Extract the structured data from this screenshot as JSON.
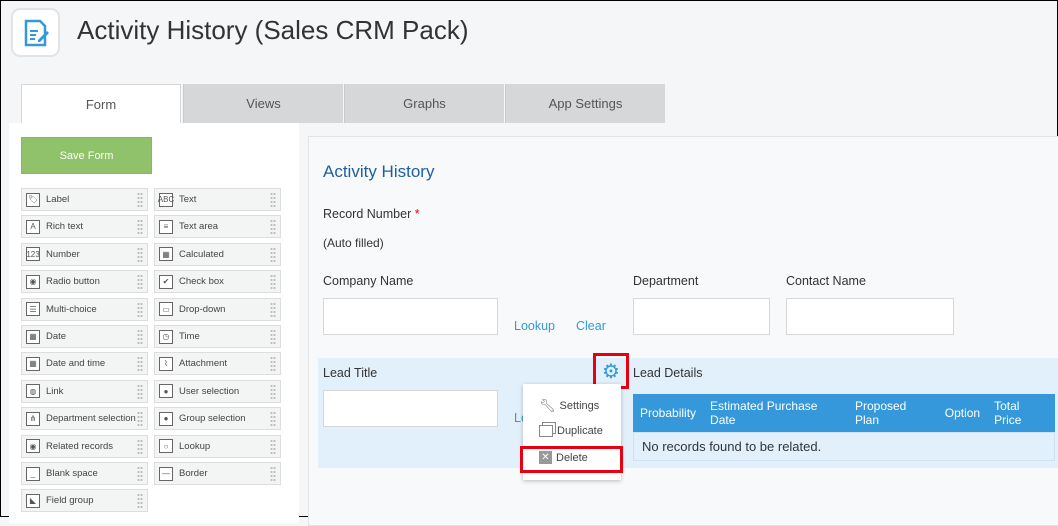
{
  "app": {
    "title": "Activity History (Sales CRM Pack)",
    "icon": "form-edit-icon"
  },
  "tabs": [
    {
      "label": "Form",
      "active": true
    },
    {
      "label": "Views"
    },
    {
      "label": "Graphs"
    },
    {
      "label": "App Settings"
    }
  ],
  "palette": {
    "save_label": "Save Form",
    "items": [
      {
        "label": "Label",
        "icon": "tag-icon"
      },
      {
        "label": "Text",
        "icon": "abc-icon"
      },
      {
        "label": "Rich text",
        "icon": "rich-text-icon"
      },
      {
        "label": "Text area",
        "icon": "text-area-icon"
      },
      {
        "label": "Number",
        "icon": "number-icon"
      },
      {
        "label": "Calculated",
        "icon": "calculator-icon"
      },
      {
        "label": "Radio button",
        "icon": "radio-icon"
      },
      {
        "label": "Check box",
        "icon": "checkbox-icon"
      },
      {
        "label": "Multi-choice",
        "icon": "multi-choice-icon"
      },
      {
        "label": "Drop-down",
        "icon": "dropdown-icon"
      },
      {
        "label": "Date",
        "icon": "date-icon"
      },
      {
        "label": "Time",
        "icon": "clock-icon"
      },
      {
        "label": "Date and time",
        "icon": "datetime-icon"
      },
      {
        "label": "Attachment",
        "icon": "paperclip-icon"
      },
      {
        "label": "Link",
        "icon": "globe-icon"
      },
      {
        "label": "User selection",
        "icon": "user-icon"
      },
      {
        "label": "Department selection",
        "icon": "org-icon"
      },
      {
        "label": "Group selection",
        "icon": "group-icon"
      },
      {
        "label": "Related records",
        "icon": "related-records-icon"
      },
      {
        "label": "Lookup",
        "icon": "lookup-icon"
      },
      {
        "label": "Blank space",
        "icon": "blank-space-icon"
      },
      {
        "label": "Border",
        "icon": "border-icon"
      },
      {
        "label": "Field group",
        "icon": "field-group-icon"
      }
    ]
  },
  "form": {
    "heading": "Activity History",
    "record_number": "Record Number",
    "required_mark": "*",
    "auto_filled": "(Auto filled)",
    "company_name": "Company Name",
    "lookup": "Lookup",
    "clear": "Clear",
    "lookup_partial": "Lo",
    "department": "Department",
    "contact_name": "Contact Name",
    "lead_title": "Lead Title",
    "lead_details": "Lead Details",
    "table_headers": [
      "Probability",
      "Estimated Purchase Date",
      "Proposed Plan",
      "Option",
      "Total Price"
    ],
    "empty_text": "No records found to be related."
  },
  "menu": {
    "items": [
      {
        "label": "Settings",
        "icon": "wrench-icon"
      },
      {
        "label": "Duplicate",
        "icon": "duplicate-icon"
      },
      {
        "label": "Delete",
        "icon": "delete-icon"
      }
    ]
  },
  "colors": {
    "accent": "#3498db",
    "save": "#8fc26a",
    "highlight": "#e60012"
  }
}
